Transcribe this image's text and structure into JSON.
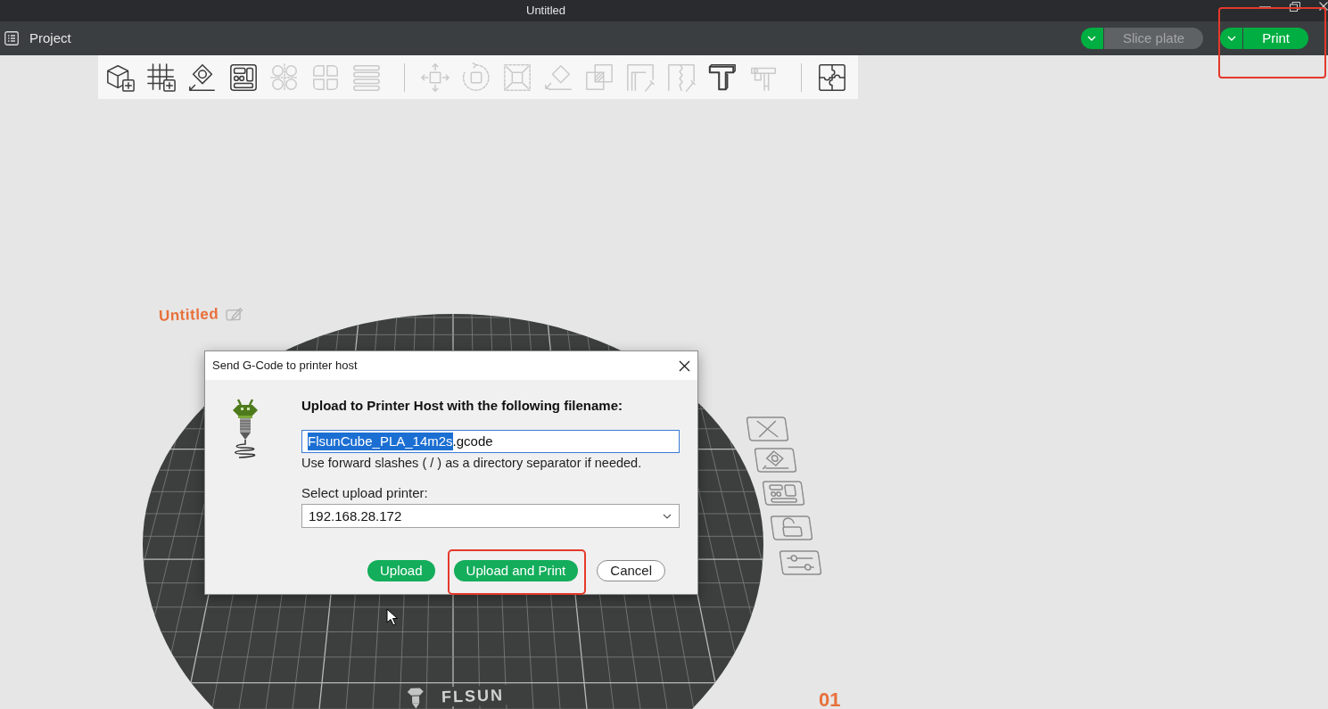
{
  "window": {
    "title": "Untitled"
  },
  "menu_bar": {
    "project": {
      "label": "Project"
    },
    "actions": [
      {
        "label": "Slice plate",
        "disabled": true,
        "highlighted": false
      },
      {
        "label": "Print",
        "disabled": false,
        "highlighted": true
      }
    ]
  },
  "toolbar": {
    "groups": [
      {
        "tools": [
          {
            "disabled": false
          },
          {
            "disabled": false
          },
          {
            "disabled": false
          },
          {
            "disabled": false
          },
          {
            "disabled": true
          },
          {
            "disabled": true
          },
          {
            "disabled": true
          }
        ]
      },
      {
        "tools": [
          {
            "disabled": true
          },
          {
            "disabled": true
          },
          {
            "disabled": true
          },
          {
            "disabled": true
          },
          {
            "disabled": true
          },
          {
            "disabled": true
          },
          {
            "disabled": true
          },
          {
            "disabled": false
          },
          {
            "disabled": true
          }
        ]
      },
      {
        "tools": [
          {
            "disabled": false
          }
        ]
      }
    ]
  },
  "plate": {
    "name": "Untitled",
    "logo": "FLSUN",
    "number": "01"
  },
  "dialog": {
    "title": "Send G-Code to printer host",
    "heading": "Upload to Printer Host with the following filename:",
    "filename": {
      "selected": "FlsunCube_PLA_14m2s",
      "rest": ".gcode"
    },
    "hint": "Use forward slashes ( / ) as a directory separator if needed.",
    "printer_label": "Select upload printer:",
    "printer": "192.168.28.172",
    "buttons": [
      {
        "label": "Upload",
        "kind": "primary",
        "highlighted": false
      },
      {
        "label": "Upload and Print",
        "kind": "primary",
        "highlighted": true
      },
      {
        "label": "Cancel",
        "kind": "secondary",
        "highlighted": false
      }
    ]
  }
}
